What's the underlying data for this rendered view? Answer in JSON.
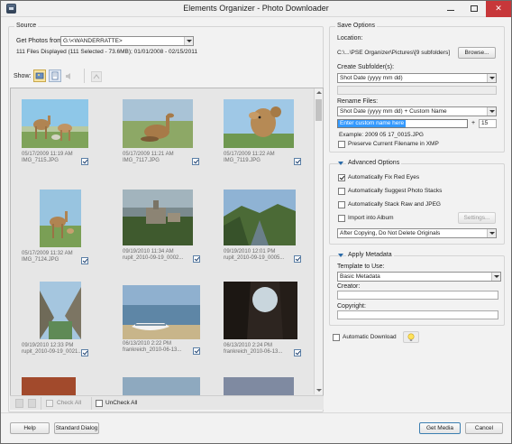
{
  "window": {
    "title": "Elements Organizer - Photo Downloader"
  },
  "source": {
    "group_title": "Source",
    "get_photos_label": "Get Photos from:",
    "get_photos_value": "G:\\<WANDERRATTE>",
    "files_info": "111 Files Displayed (111 Selected - 73.6MB); 01/01/2008 - 02/15/2011",
    "show_label": "Show:",
    "check_all": "Check All",
    "uncheck_all": "UnCheck All"
  },
  "thumbnails": [
    {
      "date": "05/17/2009 11:19 AM",
      "name": "IMG_7115.JPG",
      "checked": true
    },
    {
      "date": "05/17/2009 11:21 AM",
      "name": "IMG_7117.JPG",
      "checked": true
    },
    {
      "date": "05/17/2009 11:22 AM",
      "name": "IMG_7119.JPG",
      "checked": true
    },
    {
      "date": "05/17/2009 11:32 AM",
      "name": "IMG_7124.JPG",
      "checked": true
    },
    {
      "date": "09/19/2010 11:34 AM",
      "name": "rupit_2010-09-19_0002...",
      "checked": true
    },
    {
      "date": "09/19/2010 12:01 PM",
      "name": "rupit_2010-09-19_0005...",
      "checked": true
    },
    {
      "date": "09/19/2010 12:33 PM",
      "name": "rupit_2010-09-19_0021...",
      "checked": true
    },
    {
      "date": "06/13/2010 2:22 PM",
      "name": "frankreich_2010-06-13...",
      "checked": true
    },
    {
      "date": "06/13/2010 2:24 PM",
      "name": "frankreich_2010-06-13...",
      "checked": true
    }
  ],
  "save_options": {
    "group_title": "Save Options",
    "location_label": "Location:",
    "location_value": "C:\\...\\PSE Organizer\\Pictures\\[9 subfolders]",
    "browse_label": "Browse...",
    "create_subfolders_label": "Create Subfolder(s):",
    "create_subfolders_value": "Shot Date (yyyy mm dd)",
    "rename_files_label": "Rename Files:",
    "rename_files_value": "Shot Date (yyyy mm dd) + Custom Name",
    "custom_name_placeholder": "Enter custom name here",
    "plus_sign": "+",
    "counter_value": "15",
    "example_text": "Example:  2009 05 17_0015.JPG",
    "preserve_filename_label": "Preserve Current Filename in XMP",
    "preserve_filename_checked": false
  },
  "advanced_options": {
    "title": "Advanced Options",
    "fix_red_eyes_label": "Automatically Fix Red Eyes",
    "fix_red_eyes_checked": true,
    "suggest_stacks_label": "Automatically Suggest Photo Stacks",
    "suggest_stacks_checked": false,
    "stack_raw_label": "Automatically Stack Raw and JPEG",
    "stack_raw_checked": false,
    "import_album_label": "Import into Album",
    "import_album_checked": false,
    "settings_label": "Settings...",
    "after_copying_value": "After Copying, Do Not Delete Originals"
  },
  "apply_metadata": {
    "title": "Apply Metadata",
    "template_label": "Template to Use:",
    "template_value": "Basic Metadata",
    "creator_label": "Creator:",
    "creator_value": "",
    "copyright_label": "Copyright:",
    "copyright_value": ""
  },
  "automatic_download": {
    "label": "Automatic Download",
    "checked": false
  },
  "footer": {
    "help": "Help",
    "standard_dialog": "Standard Dialog",
    "get_media": "Get Media",
    "cancel": "Cancel"
  },
  "colors": {
    "accent_blue": "#3399ff",
    "close_red": "#c7373a",
    "panel_bg": "#f2f2f2"
  }
}
